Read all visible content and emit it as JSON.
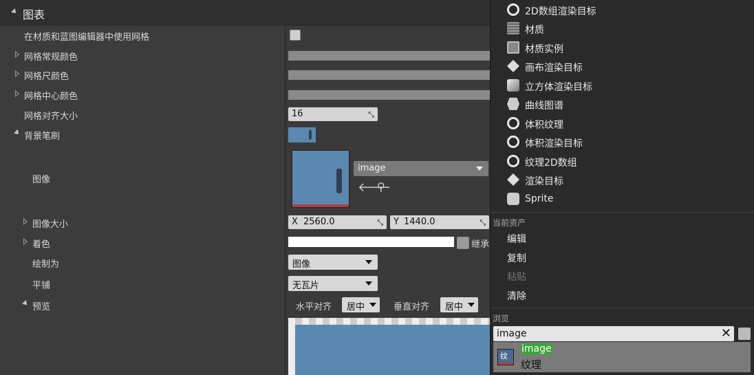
{
  "section": {
    "title": "图表"
  },
  "rows": {
    "use_grid": "在材质和蓝图编辑器中使用网格",
    "grid_regular_color": "网格常规颜色",
    "grid_ruler_color": "网格尺颜色",
    "grid_center_color": "网格中心颜色",
    "grid_snap_size": "网格对齐大小",
    "background_brush": "背景笔刷",
    "image": "图像",
    "image_size": "图像大小",
    "tint": "着色",
    "draw_as": "绘制为",
    "tiling": "平铺",
    "preview": "预览"
  },
  "values": {
    "grid_snap_size": "16",
    "image_asset": "image",
    "image_size_x_label": "X",
    "image_size_x": "2560.0",
    "image_size_y_label": "Y",
    "image_size_y": "1440.0",
    "inherit_label": "继承",
    "draw_as": "图像",
    "tiling": "无瓦片",
    "h_align_label": "水平对齐",
    "h_align": "居中",
    "v_align_label": "垂直对齐",
    "v_align": "居中"
  },
  "dropdown": {
    "asset_types": [
      {
        "label": "2D数组渲染目标",
        "icon": "circle-icon"
      },
      {
        "label": "材质",
        "icon": "material-icon"
      },
      {
        "label": "材质实例",
        "icon": "material-instance-icon"
      },
      {
        "label": "画布渲染目标",
        "icon": "canvas-render-target-icon"
      },
      {
        "label": "立方体渲染目标",
        "icon": "cube-render-target-icon"
      },
      {
        "label": "曲线图谱",
        "icon": "curve-atlas-icon"
      },
      {
        "label": "体积纹理",
        "icon": "circle-icon"
      },
      {
        "label": "体积渲染目标",
        "icon": "circle-icon"
      },
      {
        "label": "纹理2D数组",
        "icon": "circle-icon"
      },
      {
        "label": "渲染目标",
        "icon": "render-target-icon"
      },
      {
        "label": "Sprite",
        "icon": "sprite-icon"
      }
    ],
    "current_asset_title": "当前资产",
    "current_asset_items": [
      "编辑",
      "复制",
      "粘贴",
      "清除"
    ],
    "browse_title": "浏览",
    "search_value": "image",
    "result_name": "image",
    "result_type": "纹理",
    "result_icon_text": "纹"
  },
  "colors": {
    "accent_green": "#3aa63a",
    "thumb_blue": "#5a88b0"
  }
}
